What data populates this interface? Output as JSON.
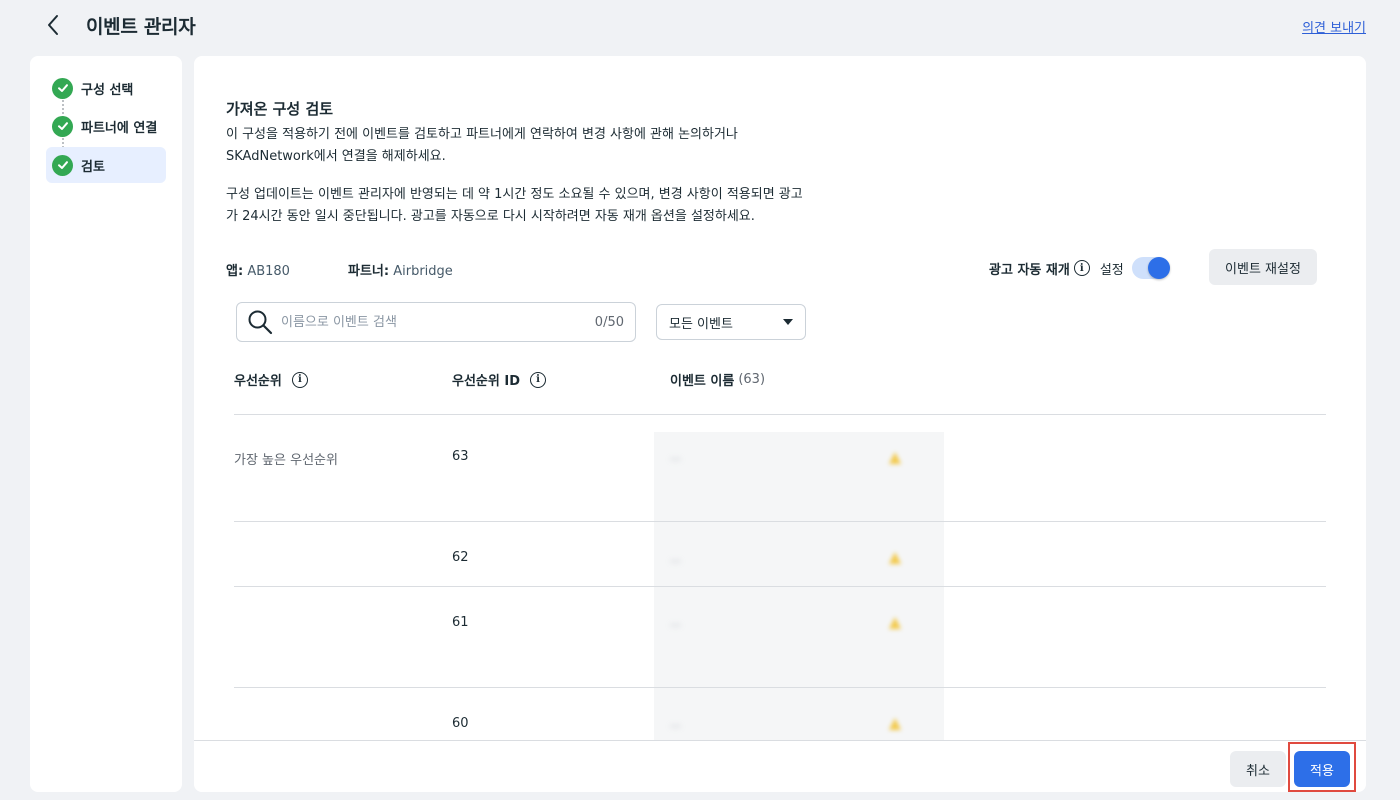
{
  "header": {
    "title": "이벤트 관리자",
    "feedback_link": "의견 보내기"
  },
  "steps": [
    {
      "label": "구성 선택",
      "status": "complete"
    },
    {
      "label": "파트너에 연결",
      "status": "complete"
    },
    {
      "label": "검토",
      "status": "complete",
      "active": true
    }
  ],
  "review": {
    "title": "가져온 구성 검토",
    "desc_line1": "이 구성을 적용하기 전에 이벤트를 검토하고 파트너에게 연락하여 변경 사항에 관해 논의하거나",
    "desc_line2": "SKAdNetwork에서 연결을 해제하세요.",
    "desc_line3": "구성 업데이트는 이벤트 관리자에 반영되는 데 약 1시간 정도 소요될 수 있으며, 변경 사항이 적용되면 광고",
    "desc_line4": "가 24시간 동안 일시 중단됩니다. 광고를 자동으로 다시 시작하려면 자동 재개 옵션을 설정하세요."
  },
  "meta": {
    "app_label": "앱:",
    "app_value": "AB180",
    "partner_label": "파트너:",
    "partner_value": "Airbridge"
  },
  "auto_restart": {
    "label": "광고 자동 재개",
    "state_label": "설정",
    "enabled": true
  },
  "reset_button": "이벤트 재설정",
  "search": {
    "placeholder": "이름으로 이벤트 검색",
    "count": "0/50"
  },
  "filter": {
    "selected": "모든 이벤트"
  },
  "table": {
    "col_priority": "우선순위",
    "col_priority_id": "우선순위 ID",
    "col_event_name": "이벤트 이름",
    "col_event_count": "(63)",
    "rows": [
      {
        "priority": "가장 높은 우선순위",
        "id": "63",
        "event_name": "…"
      },
      {
        "priority": "",
        "id": "62",
        "event_name": "…"
      },
      {
        "priority": "",
        "id": "61",
        "event_name": "…"
      },
      {
        "priority": "",
        "id": "60",
        "event_name": "…"
      }
    ]
  },
  "footer": {
    "cancel": "취소",
    "apply": "적용"
  },
  "colors": {
    "accent": "#2d6fe8",
    "success": "#33a853",
    "highlight_outline": "#e04a3f"
  }
}
